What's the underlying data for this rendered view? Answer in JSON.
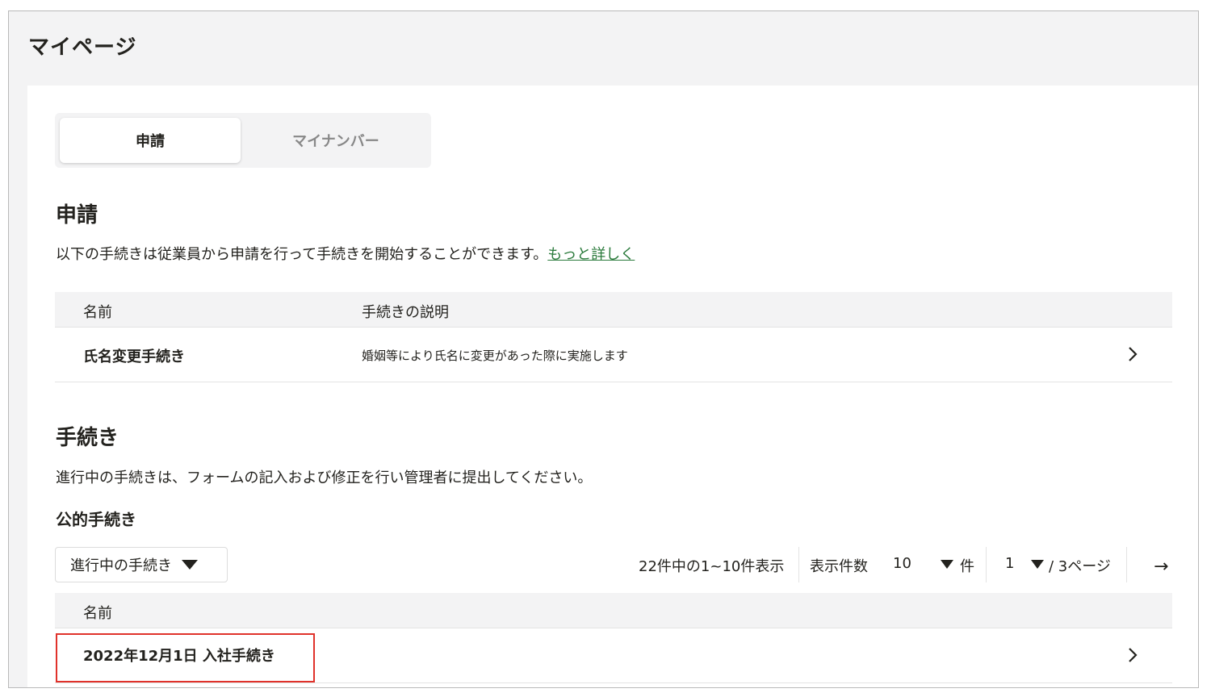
{
  "page_title": "マイページ",
  "tabs": [
    {
      "label": "申請",
      "active": true
    },
    {
      "label": "マイナンバー",
      "active": false
    }
  ],
  "application": {
    "heading": "申請",
    "description": "以下の手続きは従業員から申請を行って手続きを開始することができます。",
    "more_link": "もっと詳しく",
    "table": {
      "columns": [
        "名前",
        "手続きの説明"
      ],
      "rows": [
        {
          "name": "氏名変更手続き",
          "detail": "婚姻等により氏名に変更があった際に実施します"
        }
      ]
    }
  },
  "procedures": {
    "heading": "手続き",
    "description": "進行中の手続きは、フォームの記入および修正を行い管理者に提出してください。",
    "subheading": "公的手続き",
    "filter": {
      "selected": "進行中の手続き"
    },
    "pagination": {
      "summary": "22件中の1~10件表示",
      "per_page_label": "表示件数",
      "per_page_value": "10",
      "per_page_unit": "件",
      "current_page": "1",
      "total_pages_label": "/ 3ページ",
      "next_icon": "arrow-right-icon"
    },
    "table": {
      "columns": [
        "名前"
      ],
      "rows": [
        {
          "name": "2022年12月1日 入社手続き"
        }
      ]
    }
  },
  "colors": {
    "link": "#2a7a3b",
    "highlight": "#e0322b",
    "header_bg": "#f3f3f4"
  }
}
